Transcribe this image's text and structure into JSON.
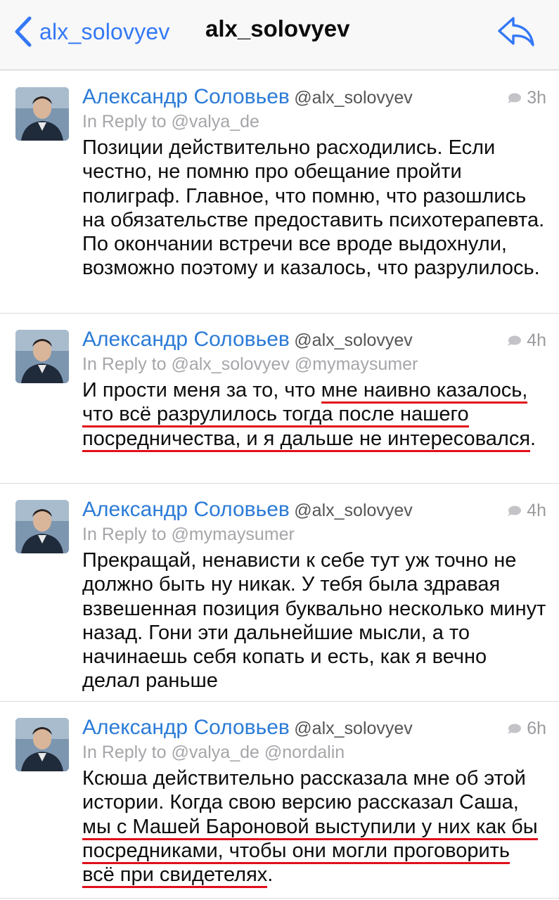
{
  "nav": {
    "back_label": "alx_solovyev",
    "title": "alx_solovyev"
  },
  "colors": {
    "accent": "#3478f6",
    "author": "#2b7bd7",
    "underline": "#e0101b"
  },
  "icons": {
    "back": "chevron-left-icon",
    "reply": "reply-arrow-icon",
    "conversation": "speech-bubble-icon"
  },
  "tweets": [
    {
      "author": "Александр Соловьев",
      "handle": "@alx_solovyev",
      "time": "3h",
      "in_reply": "In Reply to @valya_de",
      "text": "Позиции действительно расходились. Если честно, не помню про обещание пройти полиграф. Главное, что помню, что разошлись на обязательстве предоставить психотерапевта. По окончании встречи все вроде выдохнули, возможно поэтому и казалось, что разрулилось."
    },
    {
      "author": "Александр Соловьев",
      "handle": "@alx_solovyev",
      "time": "4h",
      "in_reply": "In Reply to @alx_solovyev @mymaysumer",
      "text_before": "И прости меня за то, что ",
      "text_underlined": "мне наивно казалось, что всё разрулилось тогда после нашего посредничества, и я дальше не интересовался",
      "text_after": "."
    },
    {
      "author": "Александр Соловьев",
      "handle": "@alx_solovyev",
      "time": "4h",
      "in_reply": "In Reply to @mymaysumer",
      "text": "Прекращай, ненависти к себе тут уж точно не должно быть ну никак. У тебя была здравая взвешенная позиция буквально несколько минут назад. Гони эти дальнейшие мысли, а то начинаешь себя копать и есть, как я вечно делал раньше"
    },
    {
      "author": "Александр Соловьев",
      "handle": "@alx_solovyev",
      "time": "6h",
      "in_reply": "In Reply to @valya_de @nordalin",
      "text_before": "Ксюша действительно рассказала мне об этой истории. Когда свою версию рассказал Саша, ",
      "text_underlined": "мы с Машей Бароновой выступили у них как бы посредниками, чтобы они могли проговорить всё при свидетелях",
      "text_after": "."
    }
  ]
}
